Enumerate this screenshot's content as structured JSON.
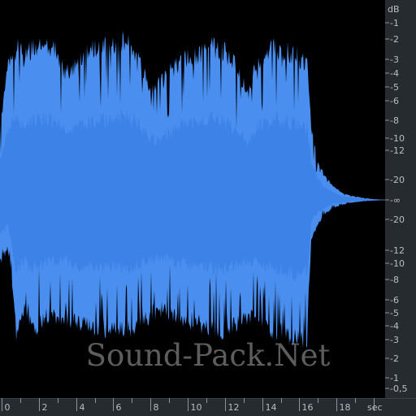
{
  "colors": {
    "background": "#000000",
    "waveform": "#4a8ff0",
    "ruler_background": "#262b30",
    "ruler_text": "#b8bec6",
    "ruler_tick": "#8c939b"
  },
  "db_ruler": {
    "unit_label": "dB",
    "top_labels": [
      "-1",
      "-2",
      "-3",
      "-4",
      "-5",
      "-6",
      "-8",
      "-10",
      "-12",
      "-20"
    ],
    "center_label": "-∞",
    "bottom_labels": [
      "-20",
      "-12",
      "-10",
      "-8",
      "-6",
      "-5",
      "-4",
      "-3",
      "-2",
      "-1",
      "-0,5"
    ]
  },
  "time_ruler": {
    "unit_label": "sec",
    "labels": [
      "0",
      "2",
      "4",
      "6",
      "8",
      "10",
      "12",
      "14",
      "16",
      "18"
    ]
  },
  "watermark": {
    "text": "Sound-Pack.Net"
  }
}
